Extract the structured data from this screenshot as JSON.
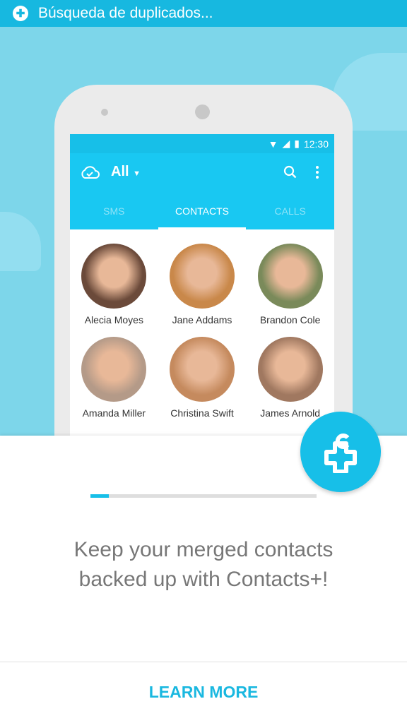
{
  "notification": {
    "title": "Búsqueda de duplicados...",
    "icon": "contacts-plus-logo-icon"
  },
  "phone": {
    "status_time": "12:30",
    "toolbar": {
      "filter": "All",
      "icons": [
        "cloud-check-icon",
        "search-icon",
        "more-vert-icon"
      ]
    },
    "tabs": [
      {
        "label": "SMS"
      },
      {
        "label": "CONTACTS",
        "active": true
      },
      {
        "label": "CALLS"
      }
    ],
    "contacts": [
      {
        "name": "Alecia Moyes",
        "color": "#6b4a3a"
      },
      {
        "name": "Jane Addams",
        "color": "#c9884a"
      },
      {
        "name": "Brandon Cole",
        "color": "#7a8a5a"
      },
      {
        "name": "Amanda Miller",
        "color": "#b49a88"
      },
      {
        "name": "Christina Swift",
        "color": "#c58a5e"
      },
      {
        "name": "James Arnold",
        "color": "#a07860"
      }
    ]
  },
  "progress": {
    "percent": 8,
    "color": "#17bfe8"
  },
  "message": {
    "line1": "Keep your merged contacts",
    "line2": "backed up with Contacts+!"
  },
  "learn_more": "LEARN MORE",
  "colors": {
    "accent": "#17bfe8",
    "background": "#7dd6ea"
  }
}
